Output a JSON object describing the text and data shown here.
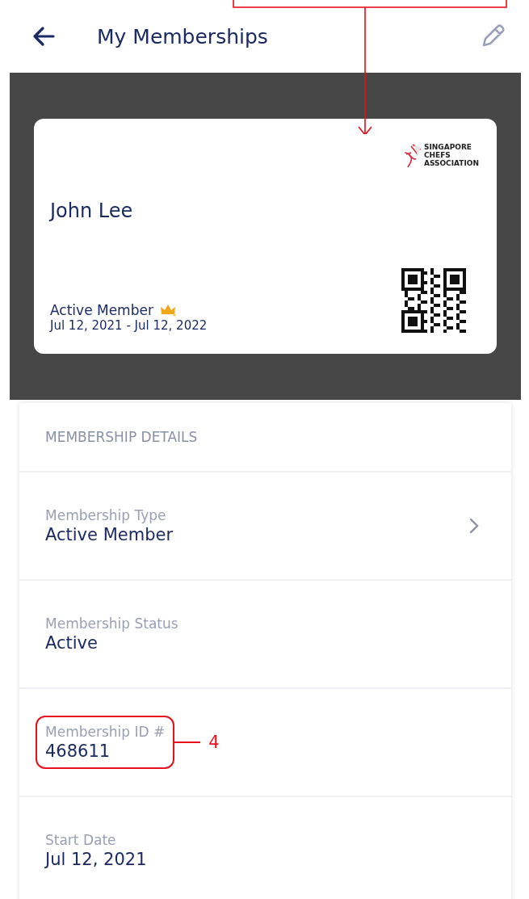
{
  "header": {
    "title": "My Memberships"
  },
  "card": {
    "name": "John Lee",
    "logo_text": [
      "SINGAPORE",
      "CHEFS",
      "ASSOCIATION"
    ],
    "membership": "Active Member",
    "period": "Jul 12, 2021 - Jul 12, 2022"
  },
  "details": {
    "heading": "MEMBERSHIP DETAILS",
    "rows": [
      {
        "kind": "link",
        "label": "Membership Type",
        "value": "Active Member"
      },
      {
        "kind": "text",
        "label": "Membership Status",
        "value": "Active"
      },
      {
        "kind": "text",
        "label": "Membership ID #",
        "value": "468611",
        "callout": "4"
      },
      {
        "kind": "text",
        "label": "Start Date",
        "value": "Jul 12, 2021"
      }
    ]
  }
}
